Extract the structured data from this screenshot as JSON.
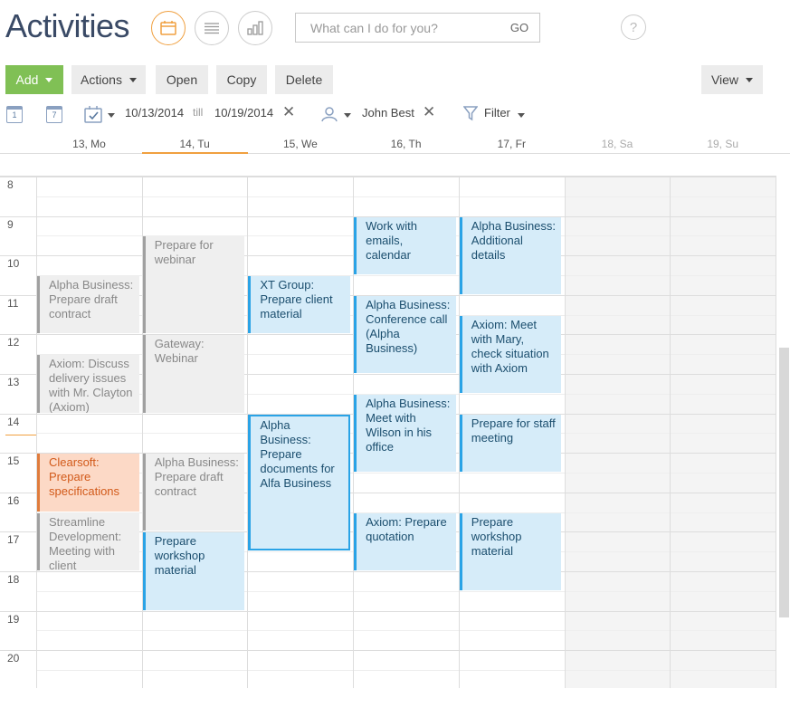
{
  "header": {
    "title": "Activities",
    "search_placeholder": "What can I do for you?",
    "search_go": "GO",
    "help": "?"
  },
  "toolbar": {
    "add": "Add",
    "actions": "Actions",
    "open": "Open",
    "copy": "Copy",
    "delete": "Delete",
    "view": "View"
  },
  "filters": {
    "day_icon_num": "1",
    "week_icon_num": "7",
    "date_from": "10/13/2014",
    "till": "till",
    "date_to": "10/19/2014",
    "owner": "John Best",
    "filter": "Filter"
  },
  "days": [
    "13, Mo",
    "14, Tu",
    "15, We",
    "16, Th",
    "17, Fr",
    "18, Sa",
    "19, Su"
  ],
  "hours": [
    "8",
    "9",
    "10",
    "11",
    "12",
    "13",
    "14",
    "15",
    "16",
    "17",
    "18",
    "19",
    "20"
  ],
  "colors": {
    "accent": "#80c055",
    "event_blue": "#d6ecf9",
    "event_border": "#2aa3e6",
    "today": "#f0a040",
    "overdue": "#fcd9c6"
  },
  "events": [
    {
      "day": 0,
      "start": 10.5,
      "end": 12.0,
      "title": "Alpha Business: Prepare draft contract",
      "style": "gray"
    },
    {
      "day": 0,
      "start": 12.5,
      "end": 14.0,
      "title": "Axiom: Discuss delivery issues with Mr. Clayton (Axiom)",
      "style": "gray"
    },
    {
      "day": 0,
      "start": 15.0,
      "end": 16.5,
      "title": "Clearsoft: Prepare specifications",
      "style": "orange"
    },
    {
      "day": 0,
      "start": 16.5,
      "end": 18.0,
      "title": "Streamline Development: Meeting with client",
      "style": "gray"
    },
    {
      "day": 1,
      "start": 9.5,
      "end": 12.0,
      "title": "Prepare for webinar",
      "style": "gray"
    },
    {
      "day": 1,
      "start": 12.0,
      "end": 14.0,
      "title": "Gateway: Webinar",
      "style": "gray"
    },
    {
      "day": 1,
      "start": 15.0,
      "end": 17.0,
      "title": "Alpha Business: Prepare draft contract",
      "style": "gray"
    },
    {
      "day": 1,
      "start": 17.0,
      "end": 19.0,
      "title": "Prepare workshop material",
      "style": "blue"
    },
    {
      "day": 2,
      "start": 10.5,
      "end": 12.0,
      "title": "XT Group: Prepare client material",
      "style": "blue"
    },
    {
      "day": 2,
      "start": 14.0,
      "end": 17.5,
      "title": "Alpha Business: Prepare documents for Alfa Business",
      "style": "blue",
      "selected": true
    },
    {
      "day": 3,
      "start": 9.0,
      "end": 10.5,
      "title": "Work with emails, calendar",
      "style": "blue"
    },
    {
      "day": 3,
      "start": 11.0,
      "end": 13.0,
      "title": "Alpha Business: Conference call (Alpha Business)",
      "style": "blue"
    },
    {
      "day": 3,
      "start": 13.5,
      "end": 15.5,
      "title": "Alpha Business: Meet with Wilson in his office",
      "style": "blue"
    },
    {
      "day": 3,
      "start": 16.5,
      "end": 18.0,
      "title": "Axiom: Prepare quotation",
      "style": "blue"
    },
    {
      "day": 4,
      "start": 9.0,
      "end": 11.0,
      "title": "Alpha Business: Additional details",
      "style": "blue"
    },
    {
      "day": 4,
      "start": 11.5,
      "end": 13.5,
      "title": "Axiom: Meet with Mary, check situation with Axiom",
      "style": "blue"
    },
    {
      "day": 4,
      "start": 14.0,
      "end": 15.5,
      "title": "Prepare for staff meeting",
      "style": "blue"
    },
    {
      "day": 4,
      "start": 16.5,
      "end": 18.5,
      "title": "Prepare workshop material",
      "style": "blue"
    }
  ]
}
